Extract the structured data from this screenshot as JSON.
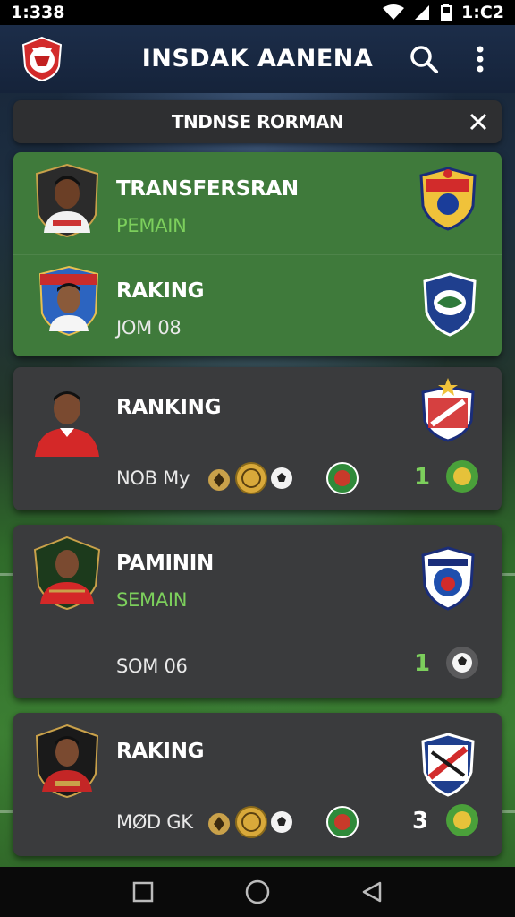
{
  "status": {
    "time_left": "1:338",
    "time_right": "1:C2"
  },
  "appbar": {
    "title": "INSDAK AANENA"
  },
  "banner": {
    "text": "TNDNSE RORMAN"
  },
  "cards": [
    {
      "title": "TRANSFERSRAN",
      "subtitle": "PEMAIN"
    },
    {
      "title": "RAKING",
      "subtitle": "JOM 08"
    },
    {
      "title": "RANKING",
      "subtitle": "NOB My",
      "score": "1"
    },
    {
      "title": "PAMININ",
      "subtitle": "SEMAIN",
      "detail": "SOM 06",
      "score": "1"
    },
    {
      "title": "RAKING",
      "subtitle": "MØD GK",
      "score": "3"
    }
  ],
  "colors": {
    "accent_green": "#7ccf5c",
    "card_green": "#3f7a3b",
    "card_dark": "#3a3b3d",
    "appbar": "#1c2d49"
  },
  "icons": {
    "search": "search-icon",
    "more": "more-vert-icon",
    "close": "close-icon",
    "nav": [
      "square-icon",
      "circle-icon",
      "triangle-back-icon"
    ]
  }
}
